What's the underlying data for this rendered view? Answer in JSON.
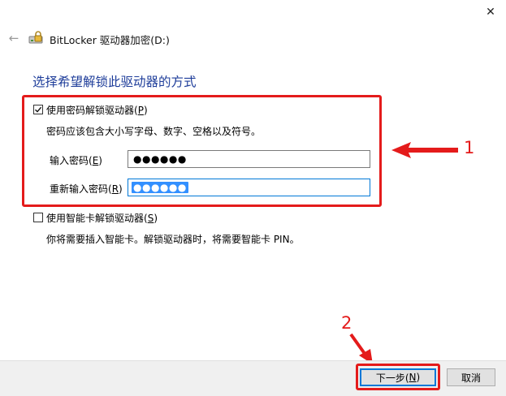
{
  "window": {
    "title": "BitLocker 驱动器加密(D:)",
    "close_glyph": "✕",
    "back_glyph": "←"
  },
  "heading": "选择希望解锁此驱动器的方式",
  "password_option": {
    "checked": true,
    "label_pre": "使用密码解锁驱动器(",
    "label_key": "P",
    "label_post": ")",
    "hint": "密码应该包含大小写字母、数字、空格以及符号。",
    "enter_label_pre": "输入密码(",
    "enter_label_key": "E",
    "enter_label_post": ")",
    "enter_value": "●●●●●●",
    "reenter_label_pre": "重新输入密码(",
    "reenter_label_key": "R",
    "reenter_label_post": ")",
    "reenter_value": "●●●●●●"
  },
  "smartcard_option": {
    "checked": false,
    "label_pre": "使用智能卡解锁驱动器(",
    "label_key": "S",
    "label_post": ")",
    "hint": "你将需要插入智能卡。解锁驱动器时，将需要智能卡 PIN。"
  },
  "buttons": {
    "next_pre": "下一步(",
    "next_key": "N",
    "next_post": ")",
    "cancel": "取消"
  },
  "annotations": {
    "num1": "1",
    "num2": "2",
    "color": "#e41b1b"
  },
  "colors": {
    "heading": "#1e3d9a",
    "selection": "#3390ff",
    "footer_bg": "#f0f0f0"
  }
}
